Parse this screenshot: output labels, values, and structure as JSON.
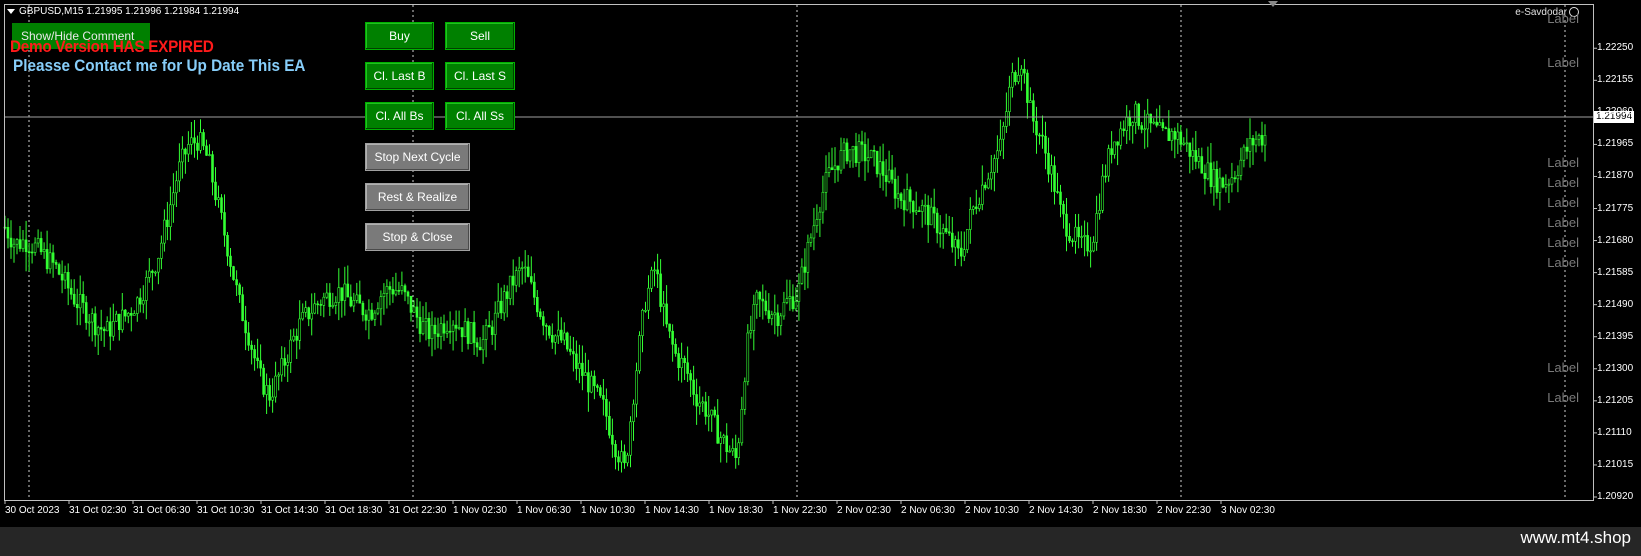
{
  "header": {
    "ohlc": "GBPUSD,M15  1.21995 1.21996 1.21984 1.21994",
    "ea_name": "e-Savdodar"
  },
  "panel": {
    "show_hide": "Show/Hide Comment",
    "expired": "Demo Version HAS EXPIRED",
    "contact": "Pleasse Contact me for Up Date This EA"
  },
  "buttons": {
    "buy": "Buy",
    "sell": "Sell",
    "close_last_buy": "Cl. Last B",
    "close_last_sell": "Cl. Last S",
    "close_all_buys": "Cl. All Bs",
    "close_all_sells": "Cl. All Ss",
    "stop_next_cycle": "Stop Next Cycle",
    "rest_realize": "Rest & Realize",
    "stop_close": "Stop & Close"
  },
  "labels": [
    "Label",
    "Label",
    "Label",
    "Label",
    "Label",
    "Label",
    "Label",
    "Label",
    "Label",
    "Label",
    "Label"
  ],
  "price_axis": {
    "ticks": [
      "1.22250",
      "1.22155",
      "1.22060",
      "1.21965",
      "1.21870",
      "1.21775",
      "1.21680",
      "1.21585",
      "1.21490",
      "1.21395",
      "1.21300",
      "1.21205",
      "1.21110",
      "1.21015",
      "1.20920"
    ],
    "current": "1.21994"
  },
  "time_axis": [
    "30 Oct 2023",
    "31 Oct 02:30",
    "31 Oct 06:30",
    "31 Oct 10:30",
    "31 Oct 14:30",
    "31 Oct 18:30",
    "31 Oct 22:30",
    "1 Nov 02:30",
    "1 Nov 06:30",
    "1 Nov 10:30",
    "1 Nov 14:30",
    "1 Nov 18:30",
    "1 Nov 22:30",
    "2 Nov 02:30",
    "2 Nov 06:30",
    "2 Nov 10:30",
    "2 Nov 14:30",
    "2 Nov 18:30",
    "2 Nov 22:30",
    "3 Nov 02:30"
  ],
  "watermark": "www.mt4.shop",
  "colors": {
    "candle": "#33ff33",
    "background": "#000000",
    "button_green": "#008000",
    "button_gray": "#7a7a7a",
    "expired_text": "#ff1a1a",
    "contact_text": "#87cefa"
  },
  "chart_data": {
    "type": "candlestick",
    "symbol": "GBPUSD",
    "timeframe": "M15",
    "ylim": [
      1.2092,
      1.2231
    ],
    "current_price": 1.21994,
    "x_ticks": [
      "30 Oct 2023",
      "31 Oct 02:30",
      "31 Oct 06:30",
      "31 Oct 10:30",
      "31 Oct 14:30",
      "31 Oct 18:30",
      "31 Oct 22:30",
      "1 Nov 02:30",
      "1 Nov 06:30",
      "1 Nov 10:30",
      "1 Nov 14:30",
      "1 Nov 18:30",
      "1 Nov 22:30",
      "2 Nov 02:30",
      "2 Nov 06:30",
      "2 Nov 10:30",
      "2 Nov 14:30",
      "2 Nov 18:30",
      "2 Nov 22:30",
      "3 Nov 02:30"
    ],
    "close_path": [
      1.2172,
      1.2167,
      1.2168,
      1.2166,
      1.2163,
      1.216,
      1.2155,
      1.215,
      1.2147,
      1.2143,
      1.2141,
      1.2144,
      1.2146,
      1.215,
      1.2156,
      1.2163,
      1.2175,
      1.2188,
      1.2196,
      1.2198,
      1.2192,
      1.2178,
      1.2165,
      1.215,
      1.214,
      1.2128,
      1.2122,
      1.2128,
      1.2136,
      1.2143,
      1.2147,
      1.215,
      1.2152,
      1.2153,
      1.215,
      1.2148,
      1.2147,
      1.2152,
      1.2154,
      1.2153,
      1.2148,
      1.2143,
      1.214,
      1.2143,
      1.2145,
      1.2142,
      1.214,
      1.2138,
      1.2143,
      1.215,
      1.2156,
      1.216,
      1.2152,
      1.2145,
      1.214,
      1.2138,
      1.2132,
      1.2128,
      1.2123,
      1.2118,
      1.2108,
      1.21,
      1.2127,
      1.215,
      1.216,
      1.2143,
      1.2134,
      1.213,
      1.2122,
      1.2118,
      1.2112,
      1.2107,
      1.2103,
      1.2136,
      1.215,
      1.2148,
      1.2146,
      1.215,
      1.2152,
      1.2165,
      1.2178,
      1.2187,
      1.2192,
      1.2195,
      1.2194,
      1.2193,
      1.219,
      1.2186,
      1.2181,
      1.218,
      1.2178,
      1.2175,
      1.2172,
      1.2168,
      1.2163,
      1.2175,
      1.2183,
      1.219,
      1.2196,
      1.2215,
      1.2222,
      1.2205,
      1.2198,
      1.2188,
      1.2175,
      1.217,
      1.2166,
      1.2168,
      1.2185,
      1.2197,
      1.2202,
      1.2206,
      1.2203,
      1.2201,
      1.2199,
      1.22,
      1.2197,
      1.2193,
      1.219,
      1.2186,
      1.2185,
      1.2188,
      1.2194,
      1.2198,
      1.2199
    ]
  }
}
